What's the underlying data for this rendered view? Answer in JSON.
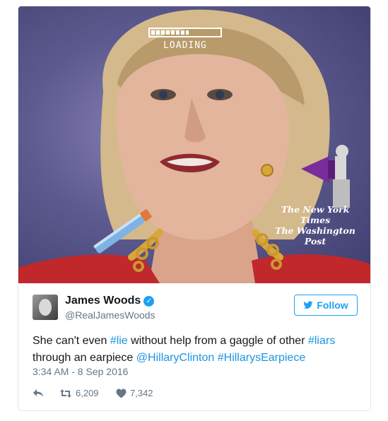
{
  "media": {
    "loading_text": "LOADING",
    "loading_progress": 0.55,
    "masthead_1": "The New York Times",
    "masthead_2": "The Washington Post"
  },
  "author": {
    "name": "James Woods",
    "handle": "@RealJamesWoods",
    "verified": true
  },
  "follow_label": "Follow",
  "tweet": {
    "text_1": "She can't even ",
    "hashtag_lie": "#lie",
    "text_2": " without help from a gaggle of other ",
    "hashtag_liars": "#liars",
    "text_3": " through an earpiece ",
    "mention": "@HillaryClinton",
    "text_4": " ",
    "hashtag_earpiece": "#HillarysEarpiece"
  },
  "timestamp": "3:34 AM - 8 Sep 2016",
  "actions": {
    "retweet_count": "6,209",
    "like_count": "7,342"
  },
  "colors": {
    "accent": "#1da1f2",
    "link": "#1b95e0",
    "muted": "#657786"
  },
  "icons": [
    "verified-badge-icon",
    "twitter-bird-icon",
    "reply-icon",
    "retweet-icon",
    "heart-icon"
  ]
}
